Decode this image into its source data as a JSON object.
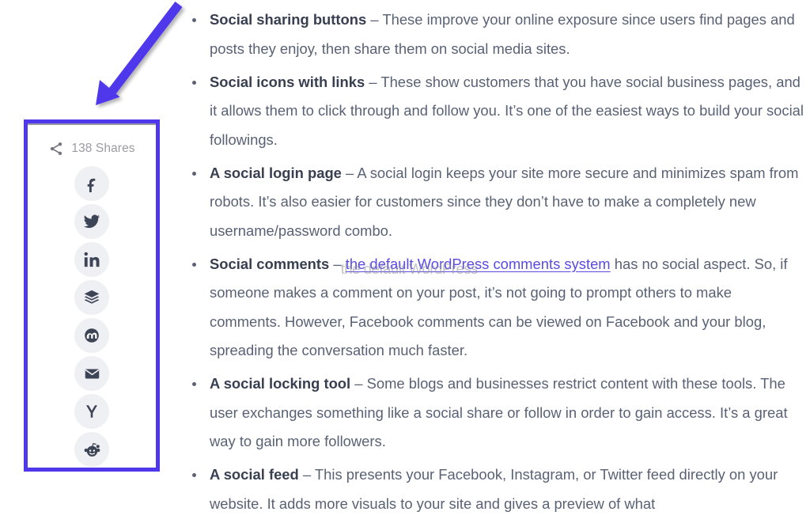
{
  "share_widget": {
    "share_icon": "share-nodes-icon",
    "share_count_label": "138 Shares",
    "highlight_color": "#4f37ec",
    "icon_bg_color": "#eff0f4",
    "social_buttons": [
      {
        "name": "facebook",
        "icon": "facebook-icon",
        "label": "f"
      },
      {
        "name": "twitter",
        "icon": "twitter-bird-icon",
        "label": ""
      },
      {
        "name": "linkedin",
        "icon": "linkedin-icon",
        "label": "in"
      },
      {
        "name": "buffer",
        "icon": "buffer-layers-icon",
        "label": ""
      },
      {
        "name": "mix",
        "icon": "mix-circle-icon",
        "label": ""
      },
      {
        "name": "email",
        "icon": "envelope-icon",
        "label": ""
      },
      {
        "name": "hacker-news",
        "icon": "hacker-news-y-icon",
        "label": "Y"
      },
      {
        "name": "reddit",
        "icon": "reddit-icon",
        "label": ""
      }
    ]
  },
  "annotation": {
    "arrow_color": "#4f37ec",
    "arrow_name": "callout-arrow"
  },
  "article": {
    "bullets": [
      {
        "term": "Social sharing buttons",
        "dash": " – ",
        "body": "These improve your online exposure since users find pages and posts they enjoy, then share them on social media sites."
      },
      {
        "term": "Social icons with links",
        "dash": " – ",
        "body": "These show customers that you have social business pages, and it allows them to click through and follow you. It’s one of the easiest ways to build your social followings."
      },
      {
        "term": "A social login page",
        "dash": " – ",
        "body": "A social login keeps your site more secure and minimizes spam from robots. It’s also easier for customers since they don’t have to make a completely new username/password combo."
      },
      {
        "term": "Social comments",
        "dash": " – ",
        "body_pre": "",
        "link_text": "the default WordPress comments system",
        "ghost_text": "the default WordPress",
        "body_post": " has no social aspect. So, if someone makes a comment on your post, it’s not going to prompt others to make comments. However, Facebook comments can be viewed on Facebook and your blog, spreading the conversation much faster."
      },
      {
        "term": "A social locking tool",
        "dash": " –  ",
        "body": "Some blogs and businesses restrict content with these tools. The user exchanges something like a social share or follow in order to gain access. It’s a great way to gain more followers."
      },
      {
        "term": "A social feed",
        "dash": " – ",
        "body": "This presents your Facebook, Instagram, or Twitter feed directly on your website. It adds more visuals to your site and gives a preview of what"
      }
    ]
  }
}
